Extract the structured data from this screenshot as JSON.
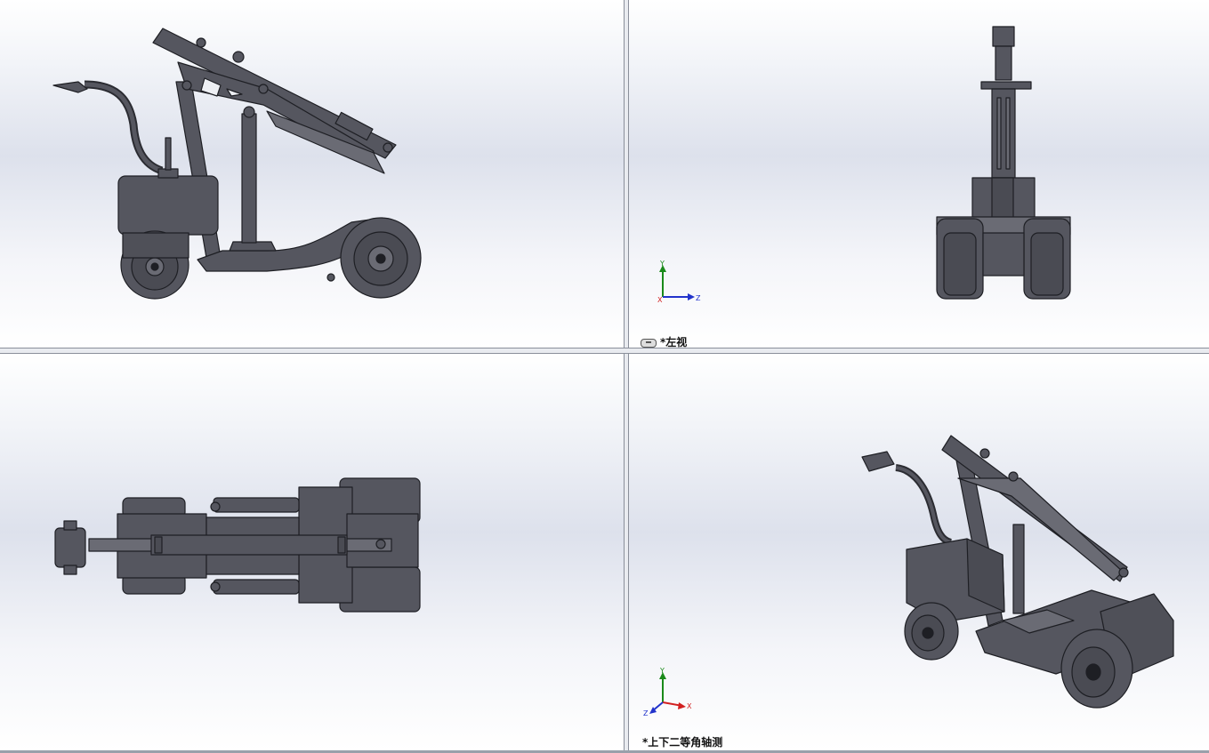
{
  "viewports": {
    "top_left": {
      "label": ""
    },
    "top_right": {
      "label": "*左视"
    },
    "bottom_left": {
      "label": ""
    },
    "bottom_right": {
      "label": "*上下二等角轴测"
    }
  },
  "triad": {
    "x": "X",
    "y": "Y",
    "z": "Z"
  },
  "colors": {
    "model": "#55565f",
    "model_edge": "#1e1f24",
    "background_top": "#ffffff",
    "background_mid": "#dde1ec",
    "axis_x": "#d22020",
    "axis_y": "#1a8a1a",
    "axis_z": "#2233cc"
  }
}
